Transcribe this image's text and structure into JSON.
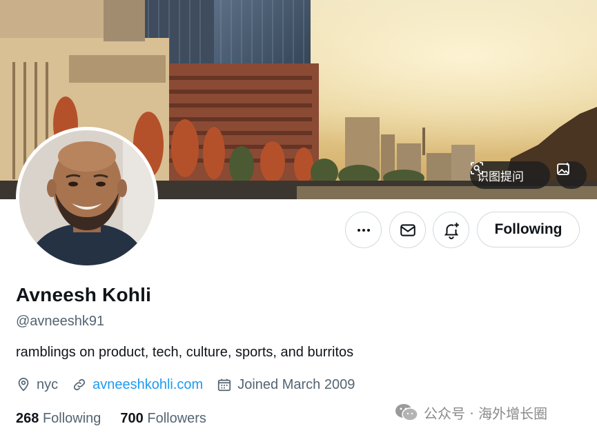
{
  "banner": {
    "ocr_button_label": "识图提问",
    "ocr_icon": "scan-text-icon",
    "image_icon": "image-sparkle-icon"
  },
  "profile": {
    "name": "Avneesh Kohli",
    "handle": "@avneeshk91",
    "bio": "ramblings on product, tech, culture, sports, and burritos",
    "location": "nyc",
    "website": "avneeshkohli.com",
    "joined": "Joined March 2009",
    "following_count": "268",
    "following_label": "Following",
    "followers_count": "700",
    "followers_label": "Followers"
  },
  "actions": {
    "more_icon": "more-horizontal-icon",
    "message_icon": "mail-icon",
    "notify_icon": "bell-plus-icon",
    "following_label": "Following"
  },
  "icons": {
    "location": "location-pin-icon",
    "link": "link-icon",
    "calendar": "calendar-icon"
  },
  "colors": {
    "link": "#1d9bf0",
    "text_primary": "#0f1419",
    "text_secondary": "#536471",
    "border": "#cfd9de"
  },
  "watermark": {
    "text": "公众号 · 海外增长圈",
    "icon": "wechat-icon"
  }
}
